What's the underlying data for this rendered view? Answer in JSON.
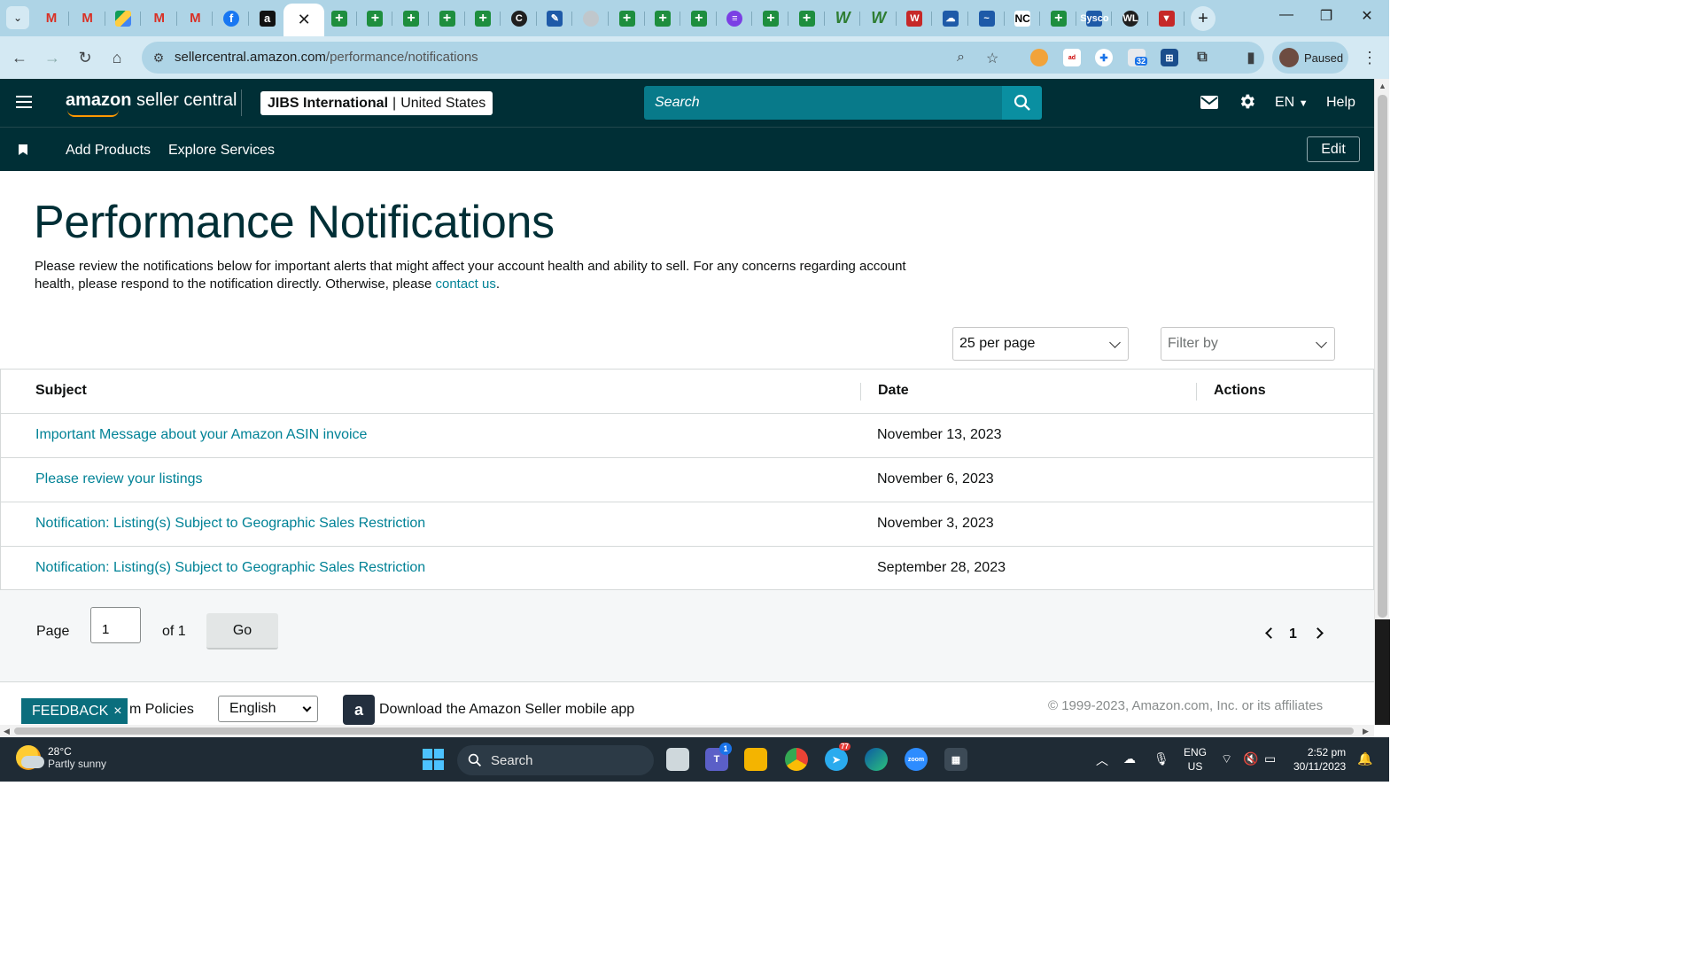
{
  "browser": {
    "tabs": [
      {
        "icon": "chevron-down-icon"
      },
      {
        "icon": "gmail-icon",
        "glyph": "M"
      },
      {
        "icon": "gmail-icon",
        "glyph": "M"
      },
      {
        "icon": "google-drive-icon",
        "glyph": ""
      },
      {
        "icon": "gmail-icon",
        "glyph": "M"
      },
      {
        "icon": "gmail-icon",
        "glyph": "M"
      },
      {
        "icon": "facebook-icon",
        "glyph": "f"
      },
      {
        "icon": "amazon-icon",
        "glyph": "a"
      },
      {
        "icon": "close-icon",
        "glyph": "✕"
      },
      {
        "icon": "sheets-icon",
        "glyph": "+"
      },
      {
        "icon": "sheets-icon",
        "glyph": "+"
      },
      {
        "icon": "sheets-icon",
        "glyph": "+"
      },
      {
        "icon": "sheets-icon",
        "glyph": "+"
      },
      {
        "icon": "sheets-icon",
        "glyph": "+"
      },
      {
        "icon": "c-circle-icon",
        "glyph": "C"
      },
      {
        "icon": "pen-icon",
        "glyph": "✎"
      },
      {
        "icon": "grey-circle-icon",
        "glyph": ""
      },
      {
        "icon": "sheets-icon",
        "glyph": "+"
      },
      {
        "icon": "sheets-icon",
        "glyph": "+"
      },
      {
        "icon": "sheets-icon",
        "glyph": "+"
      },
      {
        "icon": "purple-circle-icon",
        "glyph": "≡"
      },
      {
        "icon": "sheets-icon",
        "glyph": "+"
      },
      {
        "icon": "sheets-icon",
        "glyph": "+"
      },
      {
        "icon": "w-icon",
        "glyph": "W"
      },
      {
        "icon": "w-icon",
        "glyph": "W"
      },
      {
        "icon": "w-red-icon",
        "glyph": "W"
      },
      {
        "icon": "cloud-icon",
        "glyph": "☁"
      },
      {
        "icon": "blue-swoosh-icon",
        "glyph": "~"
      },
      {
        "icon": "nc-icon",
        "glyph": "NC"
      },
      {
        "icon": "sheets-icon",
        "glyph": "+"
      },
      {
        "icon": "sysco-icon",
        "glyph": "Sysco"
      },
      {
        "icon": "wl-icon",
        "glyph": "WL"
      },
      {
        "icon": "shield-red-icon",
        "glyph": "▼"
      }
    ],
    "new_tab_glyph": "+",
    "window_controls": {
      "minimize": "—",
      "restore": "❐",
      "close": "✕"
    },
    "url_host": "sellercentral.amazon.com",
    "url_path": "/performance/notifications",
    "profile_status": "Paused",
    "extension_badge": "32"
  },
  "header": {
    "logo_bold": "amazon",
    "logo_rest": " seller central",
    "account_name": "JIBS International",
    "account_separator": "|",
    "account_region": "United States",
    "search_placeholder": "Search",
    "language": "EN",
    "help": "Help"
  },
  "nav": {
    "links": [
      "Add Products",
      "Explore Services"
    ],
    "edit": "Edit"
  },
  "page": {
    "title": "Performance Notifications",
    "intro_text": "Please review the notifications below for important alerts that might affect your account health and ability to sell. For any concerns regarding account health, please respond to the notification directly. Otherwise, please ",
    "intro_link": "contact us",
    "intro_end": ".",
    "per_page": "25 per page",
    "filter_placeholder": "Filter by"
  },
  "table": {
    "headers": {
      "subject": "Subject",
      "date": "Date",
      "actions": "Actions"
    },
    "rows": [
      {
        "subject": "Important Message about your Amazon ASIN invoice",
        "date": "November 13, 2023"
      },
      {
        "subject": "Please review your listings",
        "date": "November 6, 2023"
      },
      {
        "subject": "Notification: Listing(s) Subject to Geographic Sales Restriction",
        "date": "November 3, 2023"
      },
      {
        "subject": "Notification: Listing(s) Subject to Geographic Sales Restriction",
        "date": "September 28, 2023"
      }
    ]
  },
  "pagination": {
    "page_label": "Page",
    "page_value": "1",
    "of_label": "of 1",
    "go": "Go",
    "current": "1"
  },
  "footer": {
    "feedback": "FEEDBACK",
    "feedback_close": "×",
    "policies": "m Policies",
    "language": "English",
    "app_icon_glyph": "a",
    "download_app": "Download the Amazon Seller mobile app",
    "copyright": "© 1999-2023, Amazon.com, Inc. or its affiliates"
  },
  "taskbar": {
    "temperature": "28°C",
    "weather": "Partly sunny",
    "search": "Search",
    "lang_top": "ENG",
    "lang_bottom": "US",
    "time": "2:52 pm",
    "date": "30/11/2023",
    "teams_badge": "1",
    "telegram_badge": "77"
  },
  "colors": {
    "header_bg": "#002f36",
    "link": "#008296",
    "search_bg": "#087a8a",
    "tabstrip": "#aed4e6",
    "toolbar": "#d4e9f3"
  }
}
